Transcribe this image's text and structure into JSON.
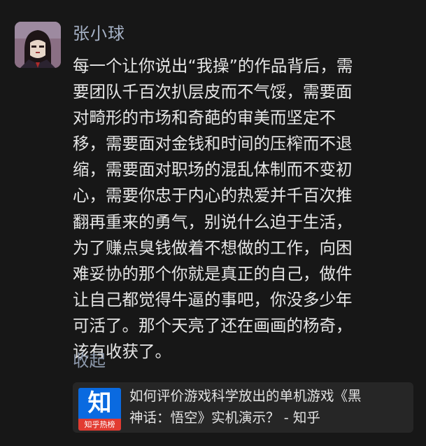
{
  "user": {
    "name": "张小球"
  },
  "comment": {
    "lines": [
      "每一个让你说出“我操”的作品背后，需",
      "要团队千百次扒层皮而不气馁，需要面",
      "对畸形的市场和奇葩的审美而坚定不",
      "移，需要面对金钱和时间的压榨而不退",
      "缩，需要面对职场的混乱体制而不变初",
      "心，需要你忠于内心的热爱并千百次推",
      "翻再重来的勇气，别说什么迫于生活，",
      "为了赚点臭钱做着不想做的工作，向困",
      "难妥协的那个你就是真正的自己，做件",
      "让自己都觉得牛逼的事吧，你没多少年",
      "可活了。那个天亮了还在画画的杨奇，",
      "该有收获了。"
    ],
    "collapse_label": "收起"
  },
  "link_card": {
    "logo_glyph": "知",
    "logo_badge": "知乎热榜",
    "title_lines": [
      "如何评价游戏科学放出的单机游戏《黑",
      "神话：悟空》实机演示？ - 知乎"
    ]
  },
  "colors": {
    "background": "#171717",
    "username": "#a5b1c5",
    "body_text": "#e6e6e6",
    "collapse": "#8b97aa",
    "card_bg": "#262626",
    "zhihu_blue": "#0a6ae0",
    "hot_red": "#e23b31"
  }
}
